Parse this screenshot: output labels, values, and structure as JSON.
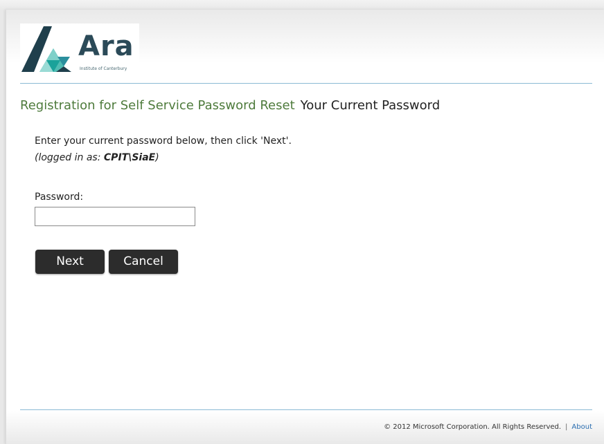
{
  "logo": {
    "wordmark": "Ara",
    "subtitle": "Institute of Canterbury",
    "colors": {
      "dark": "#1f3f4c",
      "teal": "#1aa29a",
      "light_teal": "#7fd0c9"
    }
  },
  "header": {
    "title": "Registration for Self Service Password Reset",
    "subtitle": "Your Current Password"
  },
  "form": {
    "instruction": "Enter your current password below, then click 'Next'.",
    "logged_in_prefix": "(logged in as: ",
    "logged_in_user": "CPIT\\SiaE",
    "logged_in_suffix": ")",
    "password_label": "Password:",
    "password_value": "",
    "next_label": "Next",
    "cancel_label": "Cancel"
  },
  "footer": {
    "copyright": "© 2012 Microsoft Corporation. All Rights Reserved.",
    "separator": "|",
    "about_label": "About"
  },
  "colors": {
    "heading_green": "#4e7b3c",
    "rule_blue": "#8ab9d4",
    "button_bg": "#2c2c2c"
  }
}
